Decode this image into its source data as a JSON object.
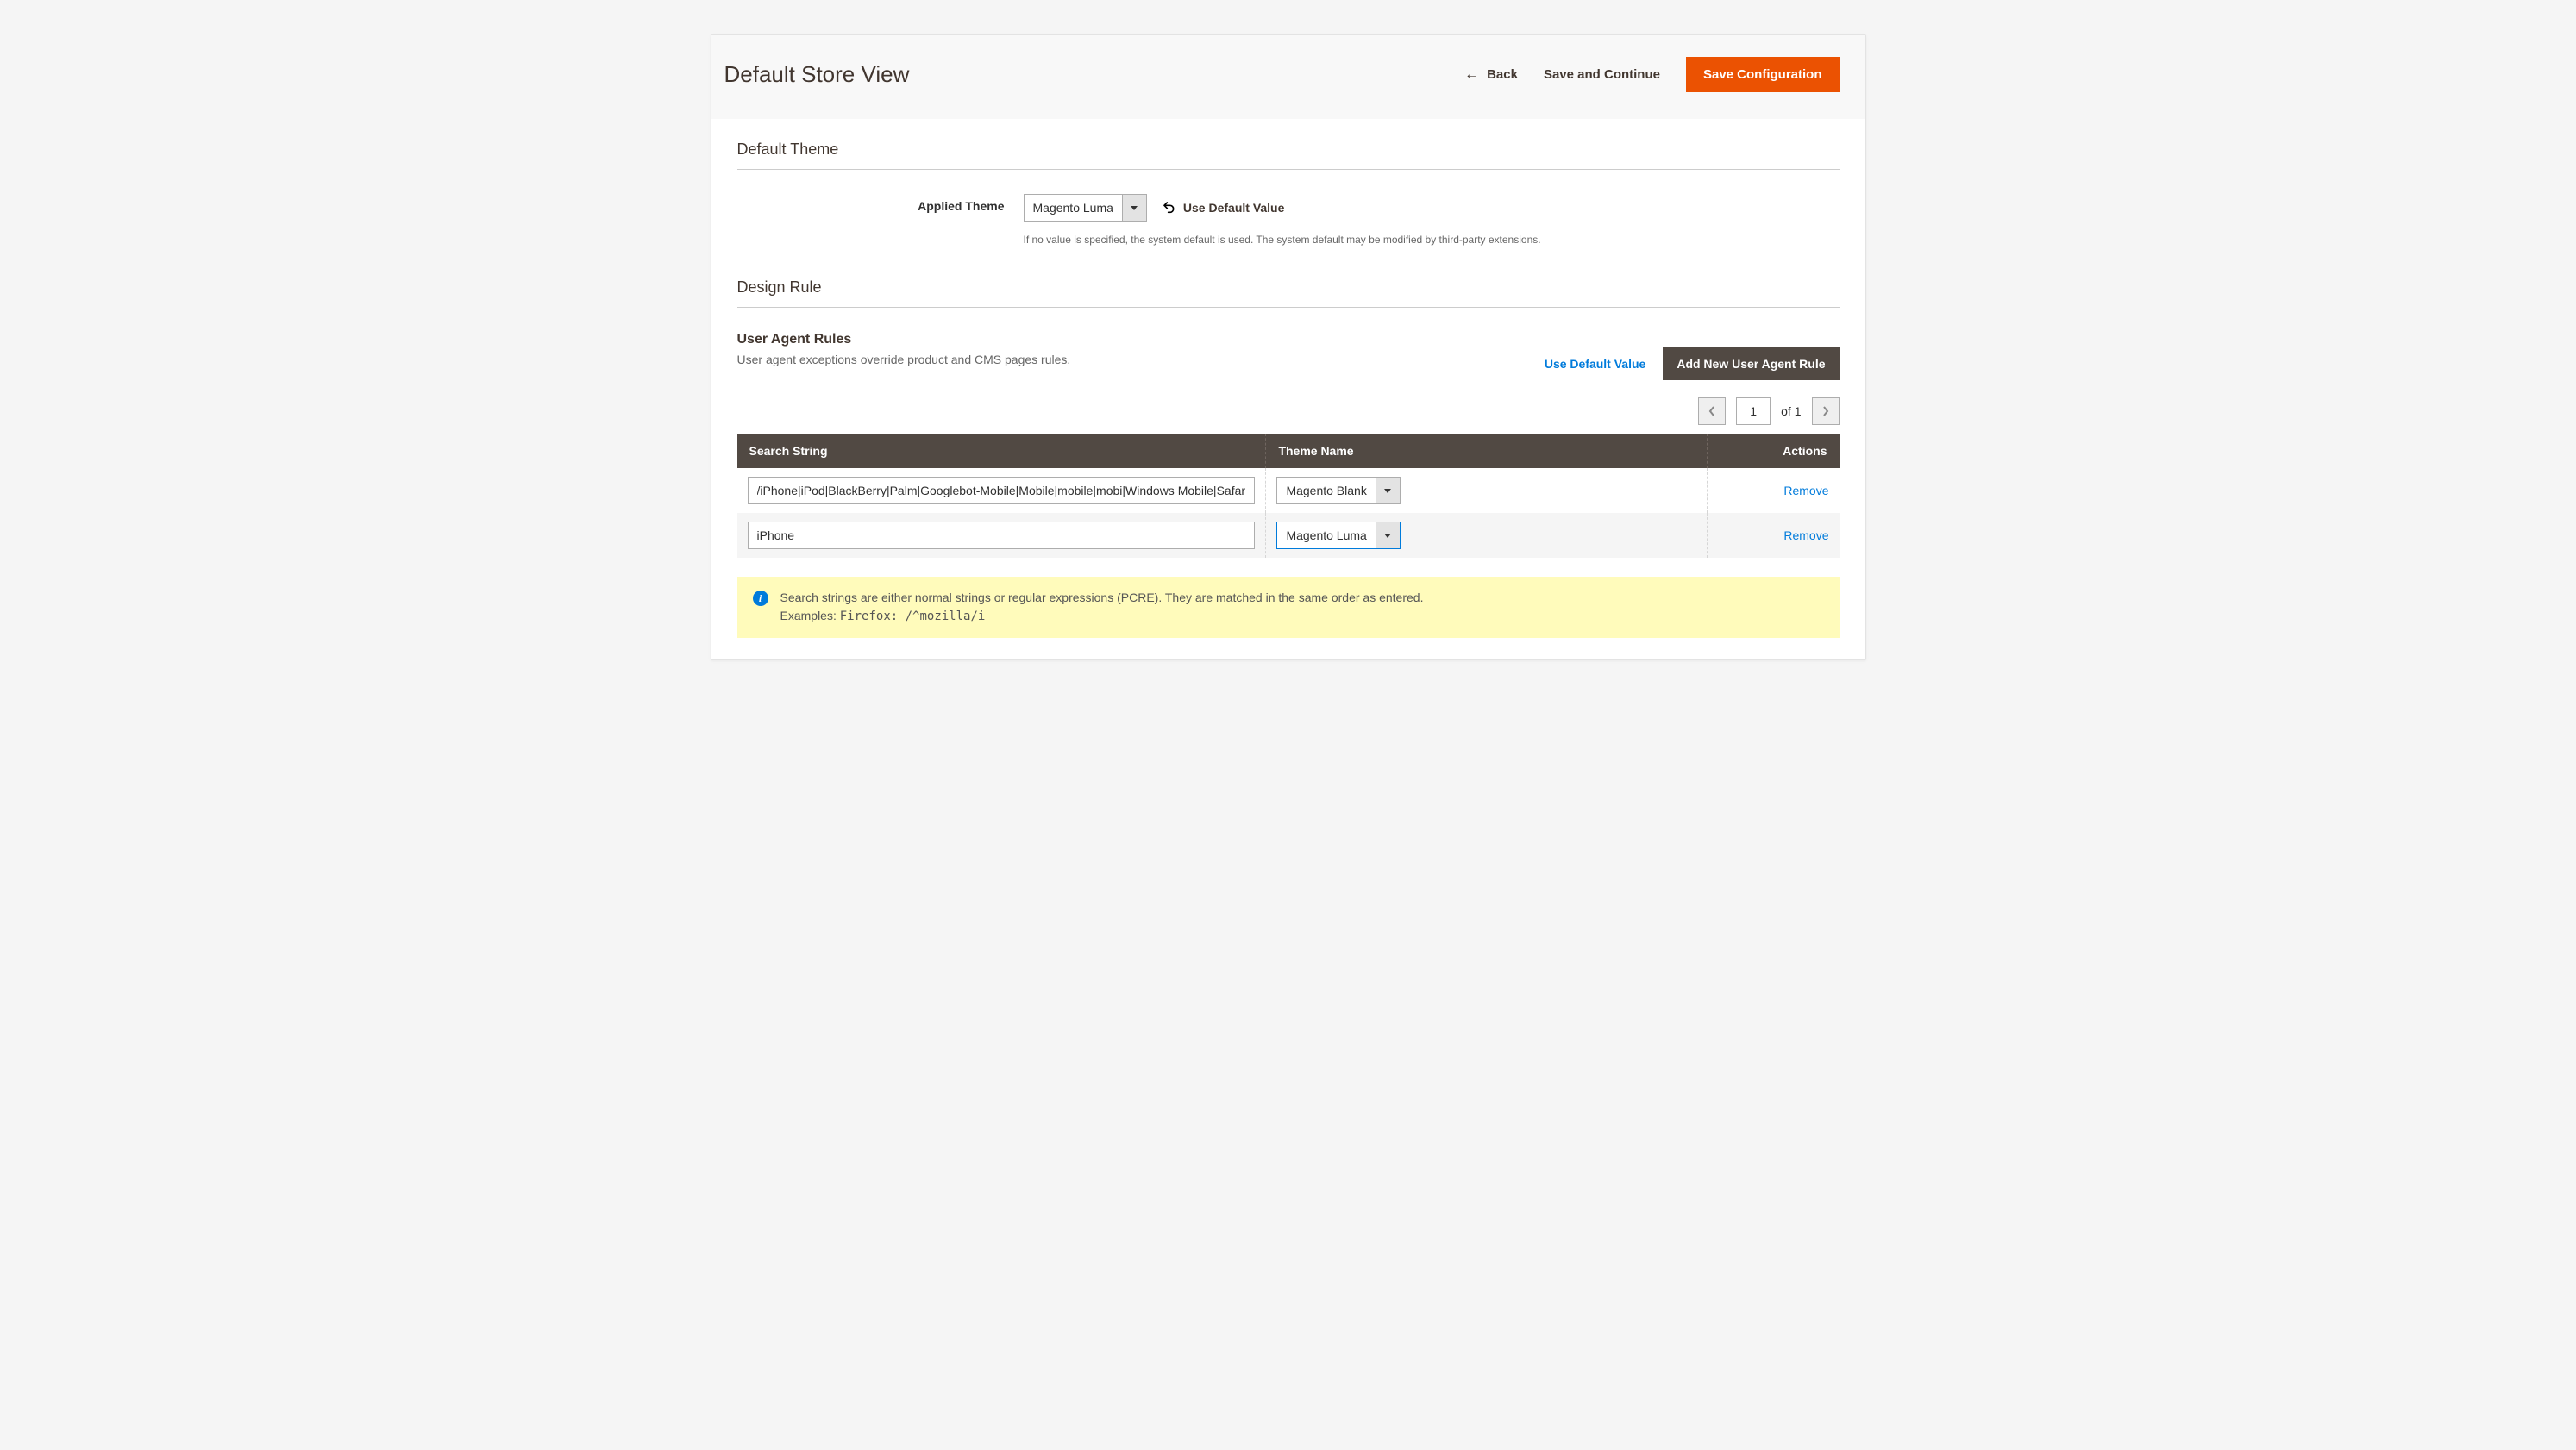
{
  "header": {
    "page_title": "Default Store View",
    "back_label": "Back",
    "save_continue_label": "Save and Continue",
    "save_config_label": "Save Configuration"
  },
  "default_theme": {
    "section_title": "Default Theme",
    "applied_theme_label": "Applied Theme",
    "applied_theme_value": "Magento Luma",
    "use_default_label": "Use Default Value",
    "help_text": "If no value is specified, the system default is used. The system default may be modified by third-party extensions."
  },
  "design_rule": {
    "section_title": "Design Rule",
    "ua_rules": {
      "title": "User Agent Rules",
      "desc": "User agent exceptions override product and CMS pages rules.",
      "use_default_label": "Use Default Value",
      "add_new_label": "Add New User Agent Rule"
    },
    "pager": {
      "current": "1",
      "of_text": "of 1"
    },
    "table": {
      "headers": {
        "search_string": "Search String",
        "theme_name": "Theme Name",
        "actions": "Actions"
      },
      "rows": [
        {
          "search_string": "/iPhone|iPod|BlackBerry|Palm|Googlebot-Mobile|Mobile|mobile|mobi|Windows Mobile|Safari",
          "theme": "Magento Blank",
          "remove": "Remove",
          "focused": false
        },
        {
          "search_string": "iPhone",
          "theme": "Magento Luma",
          "remove": "Remove",
          "focused": true
        }
      ]
    },
    "info": {
      "line1": "Search strings are either normal strings or regular expressions (PCRE). They are matched in the same order as entered.",
      "line2_prefix": "Examples: ",
      "line2_code": "Firefox: /^mozilla/i"
    }
  }
}
